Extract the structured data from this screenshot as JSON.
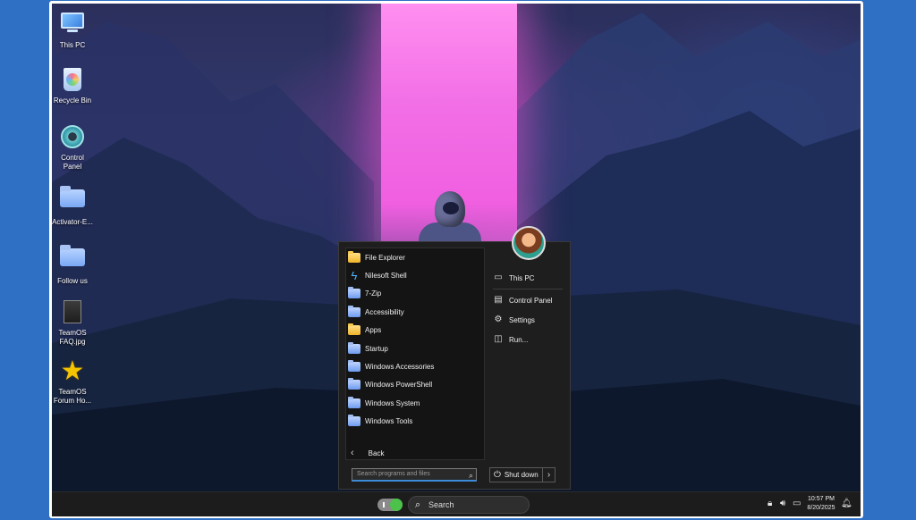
{
  "desktop_icons": [
    {
      "label": "This PC",
      "icon": "monitor-icon"
    },
    {
      "label": "Recycle Bin",
      "icon": "recycle-bin-icon"
    },
    {
      "label": "Control Panel",
      "icon": "control-panel-icon"
    },
    {
      "label": "Activator-E...",
      "icon": "folder-icon"
    },
    {
      "label": "Follow us",
      "icon": "folder-icon"
    },
    {
      "label": "TeamOS FAQ.jpg",
      "icon": "image-file-icon"
    },
    {
      "label": "TeamOS Forum Ho...",
      "icon": "star-icon"
    }
  ],
  "start_menu": {
    "programs": [
      {
        "label": "File Explorer",
        "icon": "folder-yellow"
      },
      {
        "label": "Nilesoft Shell",
        "icon": "bolt"
      },
      {
        "label": "7-Zip",
        "icon": "folder"
      },
      {
        "label": "Accessibility",
        "icon": "folder"
      },
      {
        "label": "Apps",
        "icon": "folder-yellow"
      },
      {
        "label": "Startup",
        "icon": "folder"
      },
      {
        "label": "Windows Accessories",
        "icon": "folder"
      },
      {
        "label": "Windows PowerShell",
        "icon": "folder"
      },
      {
        "label": "Windows System",
        "icon": "folder"
      },
      {
        "label": "Windows Tools",
        "icon": "folder"
      }
    ],
    "back_label": "Back",
    "search_placeholder": "Search programs and files",
    "right_items": [
      {
        "label": "This PC",
        "icon": "computer-icon"
      },
      {
        "label": "Control Panel",
        "icon": "control-panel-icon"
      },
      {
        "label": "Settings",
        "icon": "gear-icon"
      },
      {
        "label": "Run...",
        "icon": "run-icon"
      }
    ],
    "shutdown_label": "Shut down"
  },
  "taskbar": {
    "search_label": "Search",
    "time": "10:57 PM",
    "date": "8/20/2025"
  }
}
